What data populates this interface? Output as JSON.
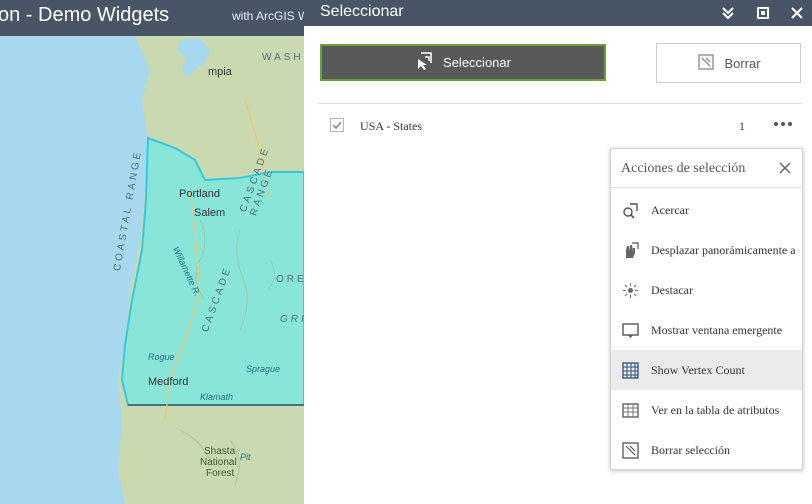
{
  "app": {
    "title": "on - Demo Widgets",
    "subtitle": "with ArcGIS W"
  },
  "map": {
    "cities": [
      "mpia",
      "Portland",
      "Salem",
      "Medford"
    ],
    "region_labels": [
      "WASHI",
      "ORE",
      "GRI",
      "Shasta",
      "National",
      "Forest"
    ],
    "range_labels": [
      "COASTAL RANGE",
      "CASCADE",
      "CASCADE RANGE"
    ],
    "river_labels": [
      "Willamette R.",
      "Rogue",
      "Klamath",
      "Sprague",
      "Pit"
    ],
    "highlight_color": "#7fe6e1"
  },
  "panel": {
    "title": "Seleccionar",
    "header_icons": [
      "collapse-icon",
      "maximize-icon",
      "close-icon"
    ],
    "select_button_label": "Seleccionar",
    "clear_button_label": "Borrar",
    "layer": {
      "name": "USA - States",
      "count": "1",
      "checked": true
    }
  },
  "popup": {
    "title": "Acciones de selección",
    "actions": [
      {
        "label": "Acercar",
        "icon": "zoom-to-icon"
      },
      {
        "label": "Desplazar panorámicamente a",
        "icon": "pan-to-icon"
      },
      {
        "label": "Destacar",
        "icon": "flash-icon"
      },
      {
        "label": "Mostrar ventana emergente",
        "icon": "popup-icon"
      },
      {
        "label": "Show Vertex Count",
        "icon": "vertex-grid-icon",
        "active": true
      },
      {
        "label": "Ver en la tabla de atributos",
        "icon": "table-icon"
      },
      {
        "label": "Borrar selección",
        "icon": "clear-selection-icon"
      }
    ]
  }
}
